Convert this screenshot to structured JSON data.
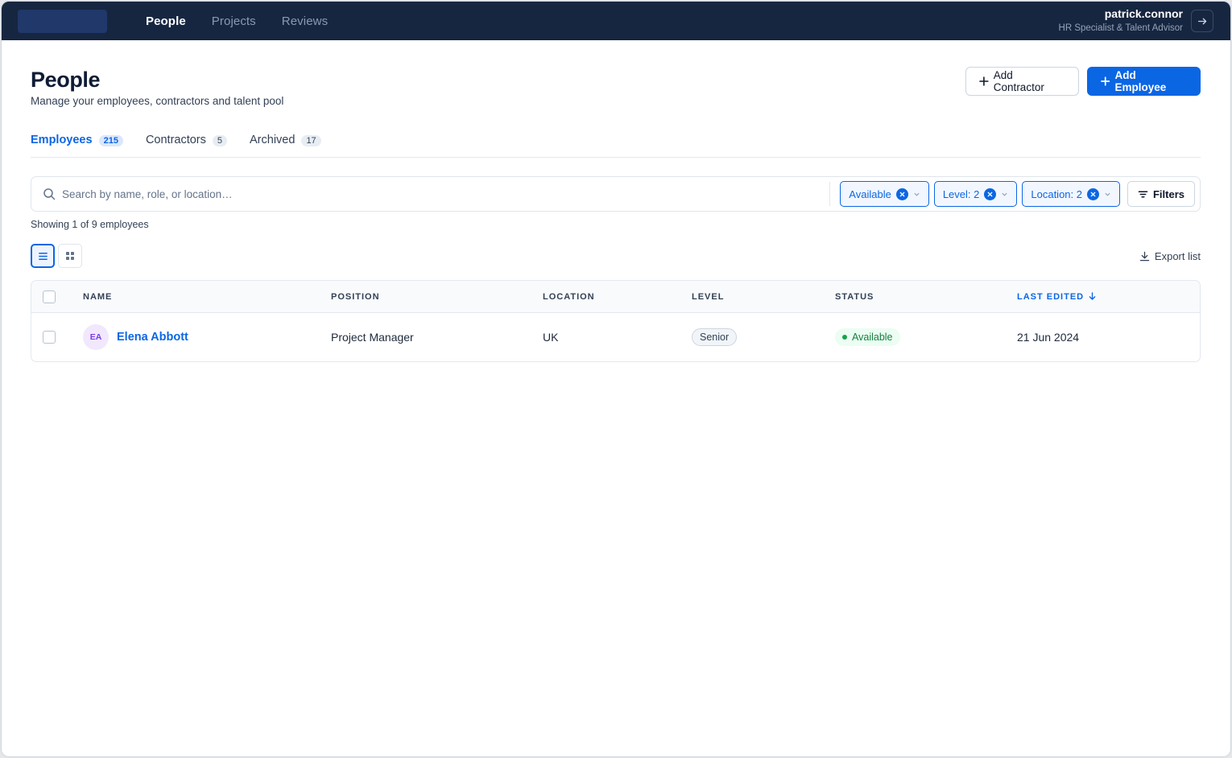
{
  "nav": {
    "items": [
      {
        "label": "People",
        "active": true
      },
      {
        "label": "Projects",
        "active": false
      },
      {
        "label": "Reviews",
        "active": false
      }
    ]
  },
  "user": {
    "name": "patrick.connor",
    "role": "HR Specialist & Talent Advisor"
  },
  "page": {
    "title": "People",
    "subtitle": "Manage your employees, contractors and talent pool"
  },
  "actions": {
    "add_contractor": "Add Contractor",
    "add_employee": "Add Employee"
  },
  "tabs": [
    {
      "label": "Employees",
      "count": "215",
      "active": true
    },
    {
      "label": "Contractors",
      "count": "5",
      "active": false
    },
    {
      "label": "Archived",
      "count": "17",
      "active": false
    }
  ],
  "search": {
    "placeholder": "Search by name, role, or location…",
    "value": ""
  },
  "filter_chips": [
    {
      "label": "Available"
    },
    {
      "label": "Level: 2"
    },
    {
      "label": "Location: 2"
    }
  ],
  "filters_button": "Filters",
  "showing_text": "Showing 1 of 9 employees",
  "export_label": "Export list",
  "table": {
    "columns": {
      "name": "NAME",
      "position": "POSITION",
      "location": "LOCATION",
      "level": "LEVEL",
      "status": "STATUS",
      "last_edited": "LAST EDITED"
    },
    "sort_column": "last_edited",
    "rows": [
      {
        "initials": "EA",
        "name": "Elena Abbott",
        "position": "Project Manager",
        "location": "UK",
        "level": "Senior",
        "status": "Available",
        "last_edited": "21 Jun 2024"
      }
    ]
  },
  "colors": {
    "topbar": "#172640",
    "accent": "#0b66e4",
    "status_available": "#16a34a",
    "avatar_bg": "#f1e8fd"
  }
}
